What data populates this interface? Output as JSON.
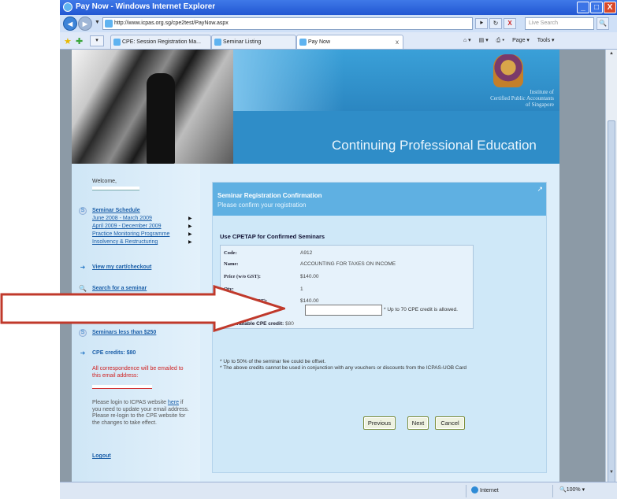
{
  "window": {
    "title": "Pay Now - Windows Internet Explorer",
    "min": "_",
    "max": "□",
    "close": "X"
  },
  "address": {
    "url": "http://www.icpas.org.sg/cpe2test/PayNow.aspx",
    "search_placeholder": "Live Search",
    "back": "◄",
    "forward": "►",
    "go": "⯈",
    "refresh": "↻",
    "stop": "X",
    "search_go": "🔍"
  },
  "tabs": [
    {
      "label": "CPE: Session Registration Ma..."
    },
    {
      "label": "Seminar Listing"
    },
    {
      "label": "Pay Now"
    }
  ],
  "toolbar": {
    "page": "Page ▾",
    "tools": "Tools ▾"
  },
  "banner": {
    "institute": "Institute of\nCertified Public Accountants\nof Singapore",
    "heading": "Continuing Professional Education"
  },
  "sidebar": {
    "welcome": "Welcome,",
    "schedule_heading": "Seminar Schedule",
    "schedule_links": [
      "June 2008 - March 2009",
      "April 2009 - December 2009",
      "Practice Monitoring Programme",
      "Insolvency & Restructuring"
    ],
    "cart": "View my cart/checkout",
    "search": "Search for a seminar",
    "less_than": "Seminars less than $250",
    "credits": "CPE credits: $80",
    "correspondence": "All correspondence will be emailed to this email address:",
    "login_note_pre": "Please login to ICPAS website ",
    "login_note_link": "here",
    "login_note_post": " if you need to update your email address. Please re-login to the CPE website for the changes to take effect.",
    "logout": "Logout"
  },
  "panel": {
    "title": "Seminar Registration Confirmation",
    "subtitle": "Please confirm your registration",
    "section": "Use CPETAP for Confirmed Seminars",
    "rows": [
      {
        "k": "Code:",
        "v": "A912"
      },
      {
        "k": "Name:",
        "v": "ACCOUNTING FOR TAXES ON INCOME"
      },
      {
        "k": "Price (w/o GST):",
        "v": "$140.00"
      },
      {
        "k": "Qty:",
        "v": "1"
      },
      {
        "k": "Amount (w/o GST):",
        "v": "$140.00"
      }
    ],
    "cpe_input": "",
    "cpe_note": "* Up to 70 CPE credit is allowed.",
    "total_label": "Total available CPE credit:",
    "total_value": "$80",
    "note1": "* Up to 50% of the seminar fee could be offset.",
    "note2": "* The above credits cannot be used in conjunction with any vouchers or discounts from the ICPAS-UOB Card",
    "btn_previous": "Previous",
    "btn_next": "Next",
    "btn_cancel": "Cancel"
  },
  "status": {
    "zone": "Internet",
    "zoom": "100%"
  },
  "colors": {
    "arrow": "#c0392b",
    "accent": "#5fb0e2",
    "link": "#1a5ea8",
    "warning_text": "#d02020"
  }
}
